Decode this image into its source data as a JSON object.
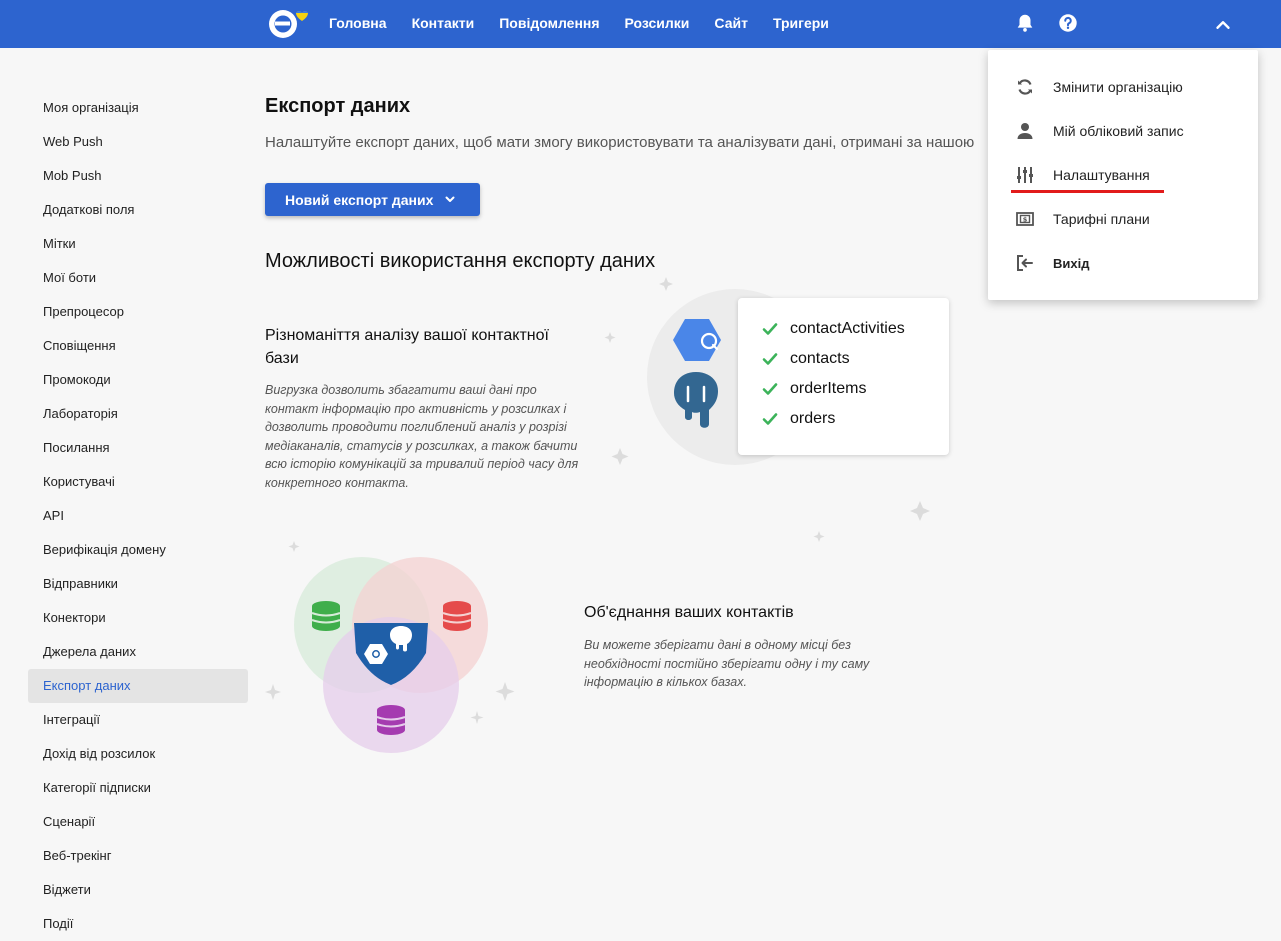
{
  "header": {
    "nav": [
      "Головна",
      "Контакти",
      "Повідомлення",
      "Розсилки",
      "Сайт",
      "Тригери"
    ],
    "icons": [
      "bell-icon",
      "help-icon",
      "chevron-up-icon"
    ]
  },
  "sidebar": {
    "items": [
      "Моя організація",
      "Web Push",
      "Mob Push",
      "Додаткові поля",
      "Мітки",
      "Мої боти",
      "Препроцесор",
      "Сповіщення",
      "Промокоди",
      "Лабораторія",
      "Посилання",
      "Користувачі",
      "API",
      "Верифікація домену",
      "Відправники",
      "Конектори",
      "Джерела даних",
      "Експорт даних",
      "Інтеграції",
      "Дохід від розсилок",
      "Категорії підписки",
      "Сценарії",
      "Веб-трекінг",
      "Віджети",
      "Події"
    ],
    "active": "Експорт даних"
  },
  "main": {
    "title": "Експорт даних",
    "subtitle": "Налаштуйте експорт даних, щоб мати змогу використовувати та аналізувати дані, отримані за нашою",
    "new_button": "Новий експорт даних",
    "section_title": "Можливості використання експорту даних",
    "block1": {
      "title": "Різноманіття аналізу вашої контактної бази",
      "description": "Вигрузка дозволить збагатити ваші дані про контакт інформацію про активність у розсилках і дозволить проводити поглиблений аналіз у розрізі медіаканалів, статусів у розсилках, а також бачити всю історію комунікацій за тривалий період часу для конкретного контакта.",
      "tables": [
        "contactActivities",
        "contacts",
        "orderItems",
        "orders"
      ]
    },
    "block2": {
      "title": "Об'єднання ваших контактів",
      "description": "Ви можете зберігати дані в одному місці без необхідності постійно зберігати одну і ту саму інформацію в кількох базах."
    }
  },
  "menu": {
    "items": [
      {
        "label": "Змінити організацію",
        "icon": "refresh-icon"
      },
      {
        "label": "Мій обліковий запис",
        "icon": "user-icon"
      },
      {
        "label": "Налаштування",
        "icon": "sliders-icon"
      },
      {
        "label": "Тарифні плани",
        "icon": "money-icon"
      },
      {
        "label": "Вихід",
        "icon": "logout-icon"
      }
    ]
  },
  "colors": {
    "brand": "#2d64cf",
    "highlight_underline": "#e21b1b",
    "check": "#3cb35a"
  }
}
